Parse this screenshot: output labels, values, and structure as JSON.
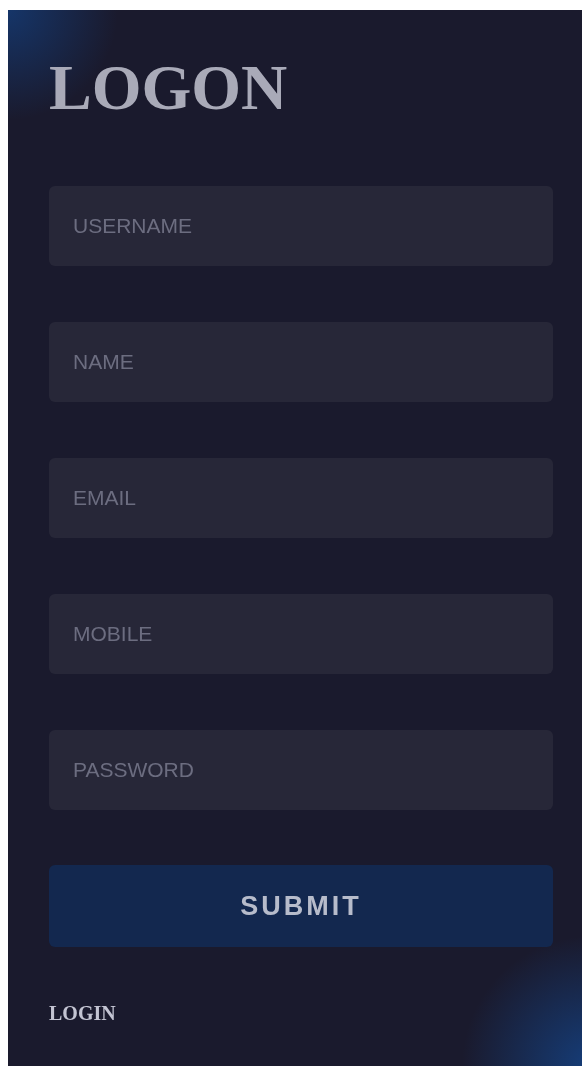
{
  "title": "LOGON",
  "fields": [
    {
      "placeholder": "USERNAME"
    },
    {
      "placeholder": "NAME"
    },
    {
      "placeholder": "EMAIL"
    },
    {
      "placeholder": "MOBILE"
    },
    {
      "placeholder": "PASSWORD"
    }
  ],
  "submit": "SUBMIT",
  "login_link": "LOGIN"
}
